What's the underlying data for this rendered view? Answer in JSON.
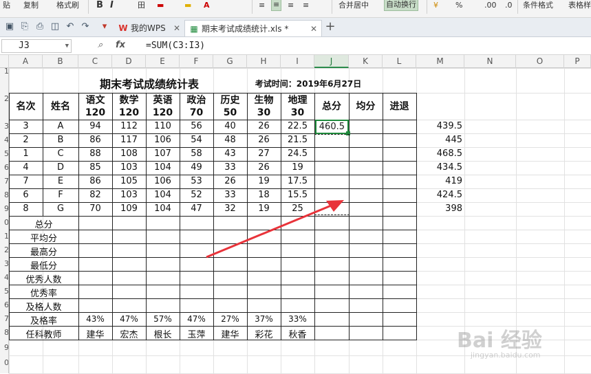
{
  "ribbon": {
    "items": [
      "贴",
      "复制",
      "格式刷",
      "B",
      "I",
      "田",
      "合并居中",
      "自动换行",
      "%",
      "条件格式",
      "表格样"
    ],
    "active": "自动换行"
  },
  "tabs": [
    {
      "label": "我的WPS",
      "icon": "wps-icon",
      "active": false
    },
    {
      "label": "期末考试成绩统计.xls *",
      "icon": "sheet-icon",
      "active": true
    }
  ],
  "formula_bar": {
    "cell_ref": "J3",
    "formula": "=SUM(C3:I3)"
  },
  "columns": [
    "A",
    "B",
    "C",
    "D",
    "E",
    "F",
    "G",
    "H",
    "I",
    "J",
    "K",
    "L",
    "M",
    "N",
    "O",
    "P"
  ],
  "selected_column": "J",
  "rows": [
    "1",
    "2",
    "3",
    "4",
    "5",
    "6",
    "7",
    "8",
    "9",
    "0",
    "1",
    "2",
    "3",
    "4",
    "5",
    "6",
    "7",
    "8",
    "9",
    "0"
  ],
  "sheet": {
    "title": "期末考试成绩统计表",
    "exam_time": "考试时间：2019年6月27日",
    "headers": [
      {
        "l1": "名次",
        "l2": ""
      },
      {
        "l1": "姓名",
        "l2": ""
      },
      {
        "l1": "语文",
        "l2": "120"
      },
      {
        "l1": "数学",
        "l2": "120"
      },
      {
        "l1": "英语",
        "l2": "120"
      },
      {
        "l1": "政治",
        "l2": "70"
      },
      {
        "l1": "历史",
        "l2": "50"
      },
      {
        "l1": "生物",
        "l2": "30"
      },
      {
        "l1": "地理",
        "l2": "30"
      },
      {
        "l1": "总分",
        "l2": ""
      },
      {
        "l1": "均分",
        "l2": ""
      },
      {
        "l1": "进退",
        "l2": ""
      }
    ],
    "students": [
      [
        "3",
        "A",
        "94",
        "112",
        "110",
        "56",
        "40",
        "26",
        "22.5"
      ],
      [
        "2",
        "B",
        "86",
        "117",
        "106",
        "54",
        "48",
        "26",
        "21.5"
      ],
      [
        "1",
        "C",
        "88",
        "108",
        "107",
        "58",
        "43",
        "27",
        "24.5"
      ],
      [
        "4",
        "D",
        "85",
        "103",
        "104",
        "49",
        "33",
        "26",
        "19"
      ],
      [
        "7",
        "E",
        "86",
        "105",
        "106",
        "53",
        "26",
        "19",
        "17.5"
      ],
      [
        "6",
        "F",
        "82",
        "103",
        "104",
        "52",
        "33",
        "18",
        "15.5"
      ],
      [
        "8",
        "G",
        "70",
        "109",
        "104",
        "47",
        "32",
        "19",
        "25"
      ]
    ],
    "j3_value": "460.5",
    "m_values": [
      "439.5",
      "445",
      "468.5",
      "434.5",
      "419",
      "424.5",
      "398"
    ],
    "stat_labels": [
      "总分",
      "平均分",
      "最高分",
      "最低分",
      "优秀人数",
      "优秀率",
      "及格人数",
      "及格率",
      "任科教师"
    ],
    "pass_rates": [
      "43%",
      "47%",
      "57%",
      "47%",
      "27%",
      "37%",
      "33%"
    ],
    "teachers": [
      "建华",
      "宏杰",
      "根长",
      "玉萍",
      "建华",
      "彩花",
      "秋香"
    ]
  },
  "watermark": {
    "main": "Bai 经验",
    "sub": "jingyan.baidu.com"
  },
  "colors": {
    "selection": "#1f8a3c",
    "arrow": "#e8333a",
    "grid": "#e1e1e1"
  }
}
